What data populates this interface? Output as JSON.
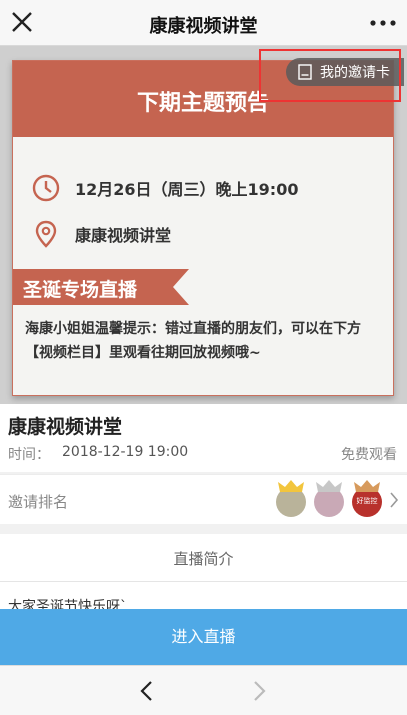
{
  "header": {
    "title": "康康视频讲堂",
    "close_icon": "close-icon",
    "more_icon": "more-icon"
  },
  "banner": {
    "heading": "下期主题预告",
    "datetime": "12月26日（周三）晚上19:00",
    "location": "康康视频讲堂",
    "ribbon": "圣诞专场直播",
    "notice": "海康小姐姐温馨提示：错过直播的朋友们，可以在下方【视频栏目】里观看往期回放视频哦~",
    "accent": "#c56450"
  },
  "invite_badge": {
    "label": "我的邀请卡"
  },
  "info": {
    "name": "康康视频讲堂",
    "time_label": "时间：",
    "time_value": "2018-12-19 19:00",
    "price": "免费观看"
  },
  "rank": {
    "label": "邀请排名",
    "avatar3_text": "好监控"
  },
  "intro": {
    "heading": "直播简介",
    "body": "大家圣诞节快乐呀`"
  },
  "enter_button": {
    "label": "进入直播",
    "color": "#4fa9e6"
  }
}
